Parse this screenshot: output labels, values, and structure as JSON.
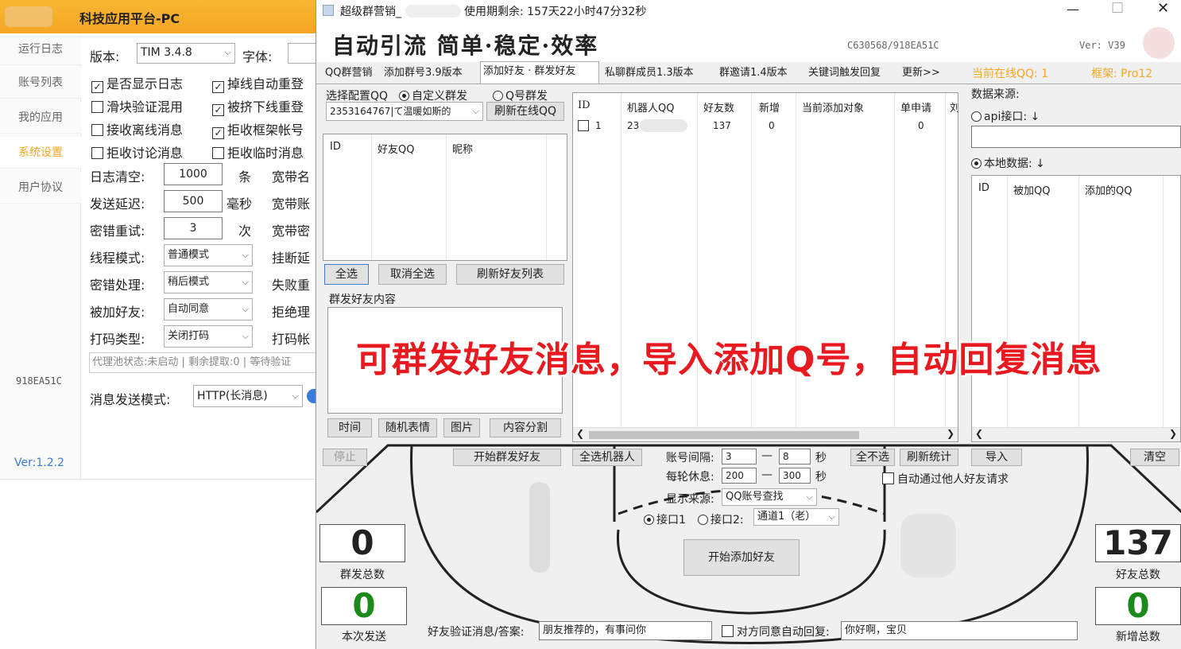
{
  "left_app": {
    "title": "科技应用平台-PC",
    "nav": [
      "运行日志",
      "账号列表",
      "我的应用",
      "系统设置",
      "用户协议"
    ],
    "machine_code": "918EA51C",
    "version": "Ver:1.2.2",
    "labels": {
      "version": "版本:",
      "font": "字体:",
      "log_clear": "日志清空:",
      "send_delay": "发送延迟:",
      "pwd_retry": "密错重试:",
      "thread_mode": "线程模式:",
      "pwd_handle": "密错处理:",
      "added_friend": "被加好友:",
      "captcha_type": "打码类型:",
      "msg_mode": "消息发送模式:",
      "unit_tiao": "条",
      "unit_ms": "毫秒",
      "unit_ci": "次",
      "broadband_name": "宽带名",
      "broadband_acct": "宽带账",
      "broadband_pwd": "宽带密",
      "hang_delay": "挂断延",
      "fail_retry": "失败重",
      "reject": "拒绝理",
      "captcha_acct": "打码帐"
    },
    "version_select": "TIM   3.4.8",
    "checkboxes": [
      {
        "label": "是否显示日志",
        "checked": true
      },
      {
        "label": "掉线自动重登",
        "checked": true
      },
      {
        "label": "滑块验证混用",
        "checked": false
      },
      {
        "label": "被挤下线重登",
        "checked": true
      },
      {
        "label": "接收离线消息",
        "checked": false
      },
      {
        "label": "拒收框架帐号",
        "checked": true
      },
      {
        "label": "拒收讨论消息",
        "checked": false
      },
      {
        "label": "拒收临时消息",
        "checked": false
      }
    ],
    "log_clear_value": "1000",
    "send_delay_value": "500",
    "pwd_retry_value": "3",
    "thread_mode_value": "普通模式",
    "pwd_handle_value": "稍后模式",
    "added_friend_value": "自动同意",
    "captcha_type_value": "关闭打码",
    "proxy_status": "代理池状态:未启动 | 剩余提取:0 | 等待验证",
    "msg_mode_value": "HTTP(长消息)"
  },
  "main_app": {
    "title": "超级群营销_",
    "remaining": "使用期剩余: 157天22小时47分32秒",
    "banner": "自动引流 简单·稳定·效率",
    "code": "C630568/918EA51C",
    "ver": "Ver: V39",
    "tabs": [
      "QQ群营销",
      "添加群号3.9版本",
      "添加好友 · 群发好友",
      "私聊群成员1.3版本",
      "群邀请1.4版本",
      "关键词触发回复",
      "更新>>"
    ],
    "online_qq": "当前在线QQ: 1",
    "frame": "框架: Pro12",
    "select_qq_label": "选择配置QQ",
    "radio_custom": "自定义群发",
    "radio_qq": "Q号群发",
    "qq_select": "2353164767|て温暖如斯的",
    "refresh_online": "刷新在线QQ",
    "friend_cols": [
      "ID",
      "好友QQ",
      "昵称"
    ],
    "select_all": "全选",
    "deselect_all": "取消全选",
    "refresh_friends": "刷新好友列表",
    "group_content_label": "群发好友内容",
    "content_btns": [
      "时间",
      "随机表情",
      "图片",
      "内容分割"
    ],
    "robot_cols": [
      "ID",
      "机器人QQ",
      "好友数",
      "新增",
      "当前添加对象",
      "单申请",
      "刘"
    ],
    "robot_rows": [
      {
        "id": "1",
        "qq": "23",
        "friends": "137",
        "new": "0",
        "target": "",
        "single": "0"
      }
    ],
    "data_source": "数据来源:",
    "api_label": "api接口: ↓",
    "local_label": "本地数据: ↓",
    "local_cols": [
      "ID",
      "被加QQ",
      "添加的QQ"
    ],
    "overlay": "可群发好友消息，导入添加Q号，自动回复消息",
    "stop": "停止",
    "start_group_send": "开始群发好友",
    "select_all_robots": "全选机器人",
    "acct_interval": "账号间隔:",
    "interval_min": "3",
    "interval_max": "8",
    "sec": "秒",
    "round_rest": "每轮休息:",
    "rest_min": "200",
    "rest_max": "300",
    "dash": "—",
    "deselect_all2": "全不选",
    "refresh_stats": "刷新统计",
    "import": "导入",
    "clear": "清空",
    "auto_accept": "自动通过他人好友请求",
    "display_source": "显示来源:",
    "display_source_value": "QQ账号查找",
    "iface1": "接口1",
    "iface2": "接口2:",
    "channel": "通道1（老）",
    "start_add": "开始添加好友",
    "stat_group_total": "0",
    "stat_group_total_label": "群发总数",
    "stat_this_send": "0",
    "stat_this_send_label": "本次发送",
    "stat_friend_total": "137",
    "stat_friend_total_label": "好友总数",
    "stat_new_total": "0",
    "stat_new_total_label": "新增总数",
    "verify_label": "好友验证消息/答案:",
    "verify_value": "朋友推荐的，有事问你",
    "auto_reply_label": "对方同意自动回复:",
    "auto_reply_value": "你好啊，宝贝"
  },
  "colors": {
    "accent_orange": "#f5a623",
    "overlay_red": "#e8191f",
    "stat_green": "#1a8a1a"
  }
}
